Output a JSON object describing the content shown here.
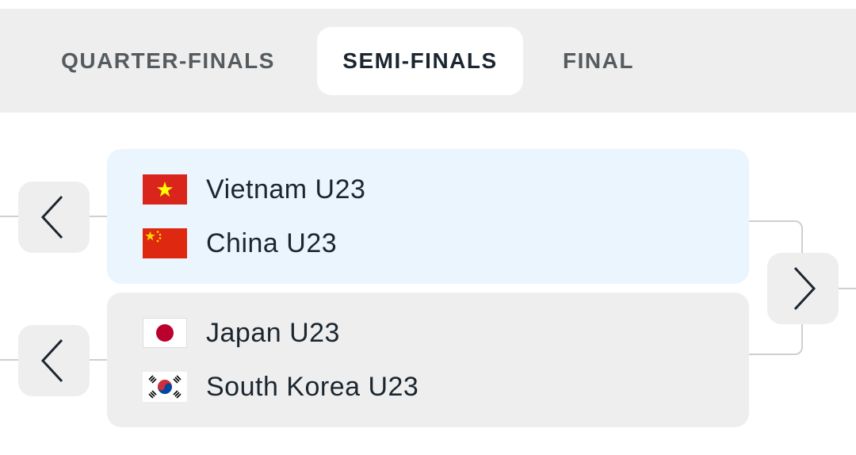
{
  "tabs": [
    {
      "label": "QUARTER-FINALS",
      "active": false
    },
    {
      "label": "SEMI-FINALS",
      "active": true
    },
    {
      "label": "FINAL",
      "active": false
    }
  ],
  "matches": [
    {
      "highlighted": true,
      "teams": [
        {
          "name": "Vietnam U23",
          "flag": "vietnam-flag-icon"
        },
        {
          "name": "China U23",
          "flag": "china-flag-icon"
        }
      ]
    },
    {
      "highlighted": false,
      "teams": [
        {
          "name": "Japan U23",
          "flag": "japan-flag-icon"
        },
        {
          "name": "South Korea U23",
          "flag": "south-korea-flag-icon"
        }
      ]
    }
  ],
  "nav": {
    "prev_icon": "chevron-left-icon",
    "next_icon": "chevron-right-icon"
  },
  "colors": {
    "tab_bar_bg": "#eeeeee",
    "active_tab_bg": "#ffffff",
    "highlight_card_bg": "#ebf5fe",
    "card_bg": "#eeeeee",
    "text": "#1b2630",
    "bracket_line": "#cfcfcf"
  }
}
